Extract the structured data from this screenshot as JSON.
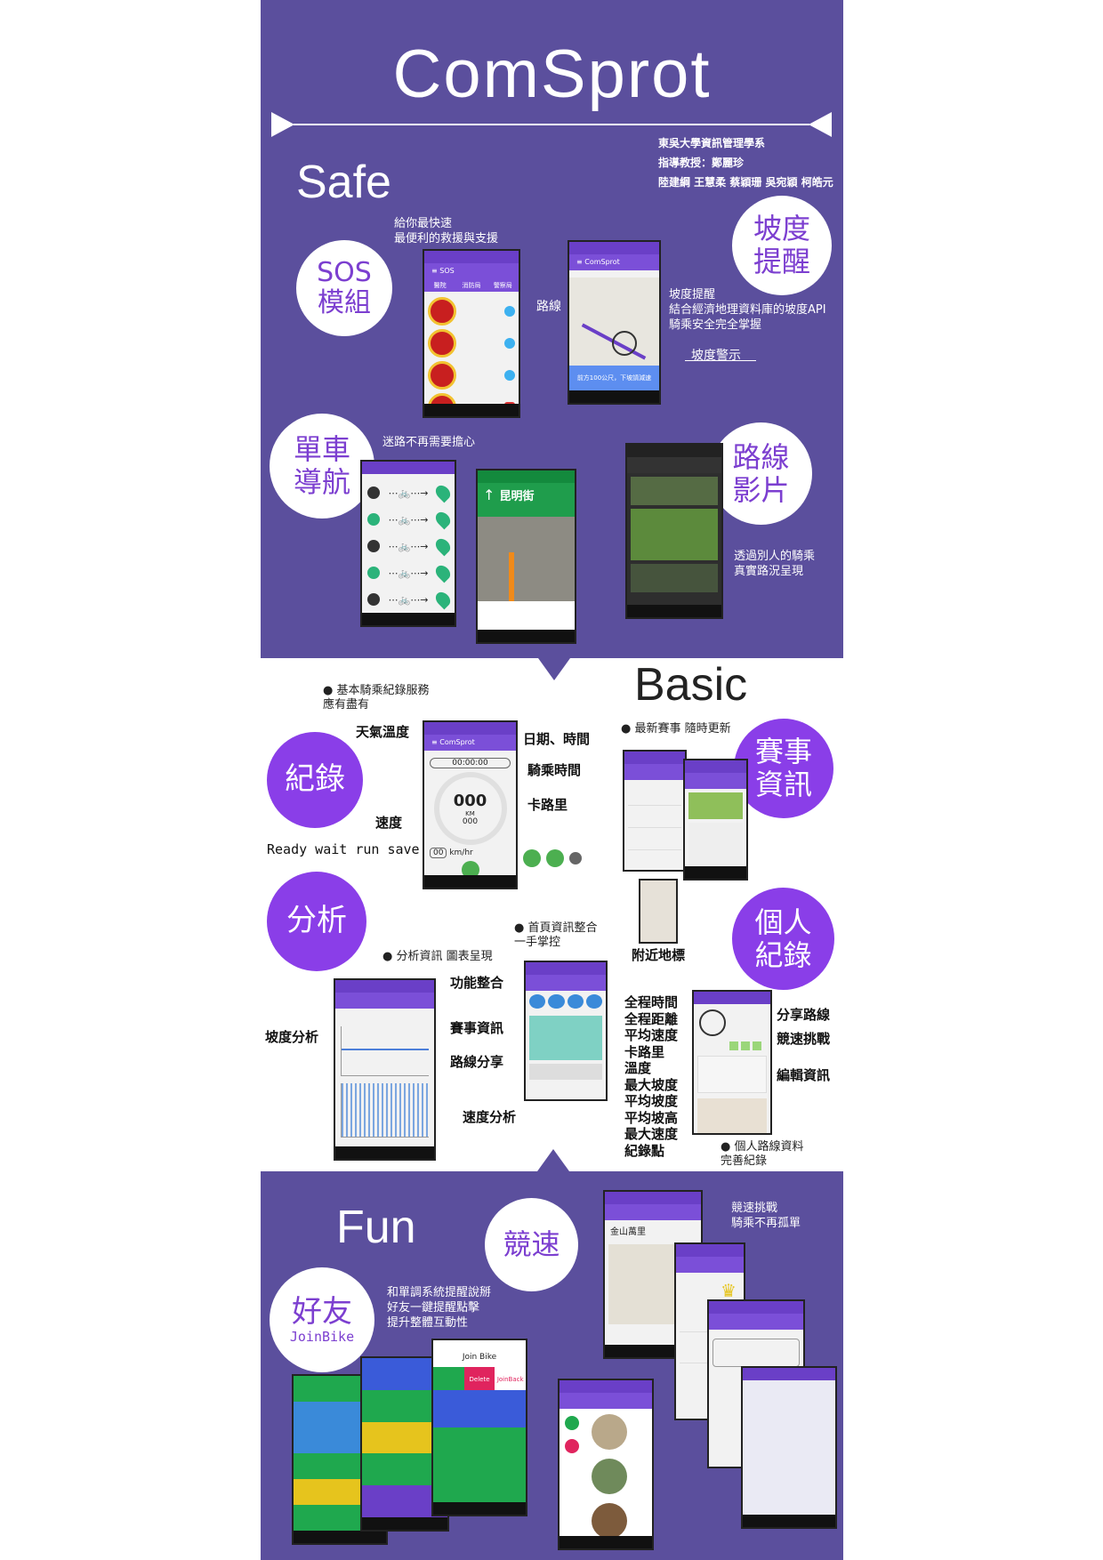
{
  "title": "ComSprot",
  "credits": [
    "東吳大學資訊管理學系",
    "指導教授：鄭麗珍",
    "陸建綱 王慧柔 蔡穎珊 吳宛穎 柯皓元"
  ],
  "safe": {
    "heading": "Safe",
    "sos": {
      "circle": "SOS\n模組",
      "desc": "給你最快速\n最便利的救援與支援",
      "tabs": [
        "醫院",
        "消防局",
        "警察局"
      ]
    },
    "slope": {
      "circle": "坡度\n提醒",
      "desc": "坡度提醒\n結合經濟地理資料庫的坡度API\n騎乘安全完全掌握",
      "route_label": "路線",
      "warning_label": "坡度警示",
      "warning_banner": "前方100公尺，下坡請減速"
    },
    "nav": {
      "circle": "單車\n導航",
      "desc": "迷路不再需要擔心",
      "street": "昆明街"
    },
    "video": {
      "circle": "路線\n影片",
      "desc": "透過別人的騎乘\n真實路況呈現"
    }
  },
  "basic": {
    "heading": "Basic",
    "record": {
      "circle": "紀錄",
      "bullet": "● 基本騎乘紀錄服務\n應有盡有",
      "labels": {
        "weather": "天氣溫度",
        "datetime": "日期、時間",
        "ride_time": "騎乘時間",
        "calorie": "卡路里",
        "speed": "速度",
        "states": "Ready wait run save"
      },
      "readouts": {
        "timer": "00:00:00",
        "distance": "000",
        "unit": "KM",
        "calorie_value": "000",
        "speed_value": "00",
        "speed_unit": "km/hr"
      }
    },
    "event": {
      "circle": "賽事\n資訊",
      "bullet": "● 最新賽事 隨時更新"
    },
    "analysis": {
      "circle": "分析",
      "bullet": "● 分析資訊 圖表呈現",
      "slope_label": "坡度分析",
      "speed_label": "速度分析"
    },
    "home": {
      "bullet": "● 首頁資訊整合\n一手掌控",
      "labels": [
        "功能整合",
        "賽事資訊",
        "路線分享"
      ],
      "nearby": "附近地標"
    },
    "personal": {
      "circle": "個人\n紀錄",
      "stats": [
        "全程時間",
        "全程距離",
        "平均速度",
        "卡路里",
        "溫度",
        "最大坡度",
        "平均坡度",
        "平均坡高",
        "最大速度",
        "紀錄點"
      ],
      "labels": [
        "分享路線",
        "競速挑戰",
        "編輯資訊"
      ],
      "bullet": "● 個人路線資料\n完善紀錄"
    }
  },
  "fun": {
    "heading": "Fun",
    "race": {
      "circle": "競速",
      "desc": "競速挑戰\n騎乘不再孤單",
      "place": "金山萬里"
    },
    "friend": {
      "circle": "好友",
      "sub": "JoinBike",
      "desc": "和單調系統提醒說掰\n好友一鍵提醒點擊\n提升整體互動性",
      "app_title": "Join Bike",
      "buttons": [
        "Delete",
        "JoinBack"
      ]
    }
  },
  "colors": {
    "panel": "#5b4f9d",
    "accent": "#8a3ee8",
    "appbar": "#6a3fc7"
  }
}
